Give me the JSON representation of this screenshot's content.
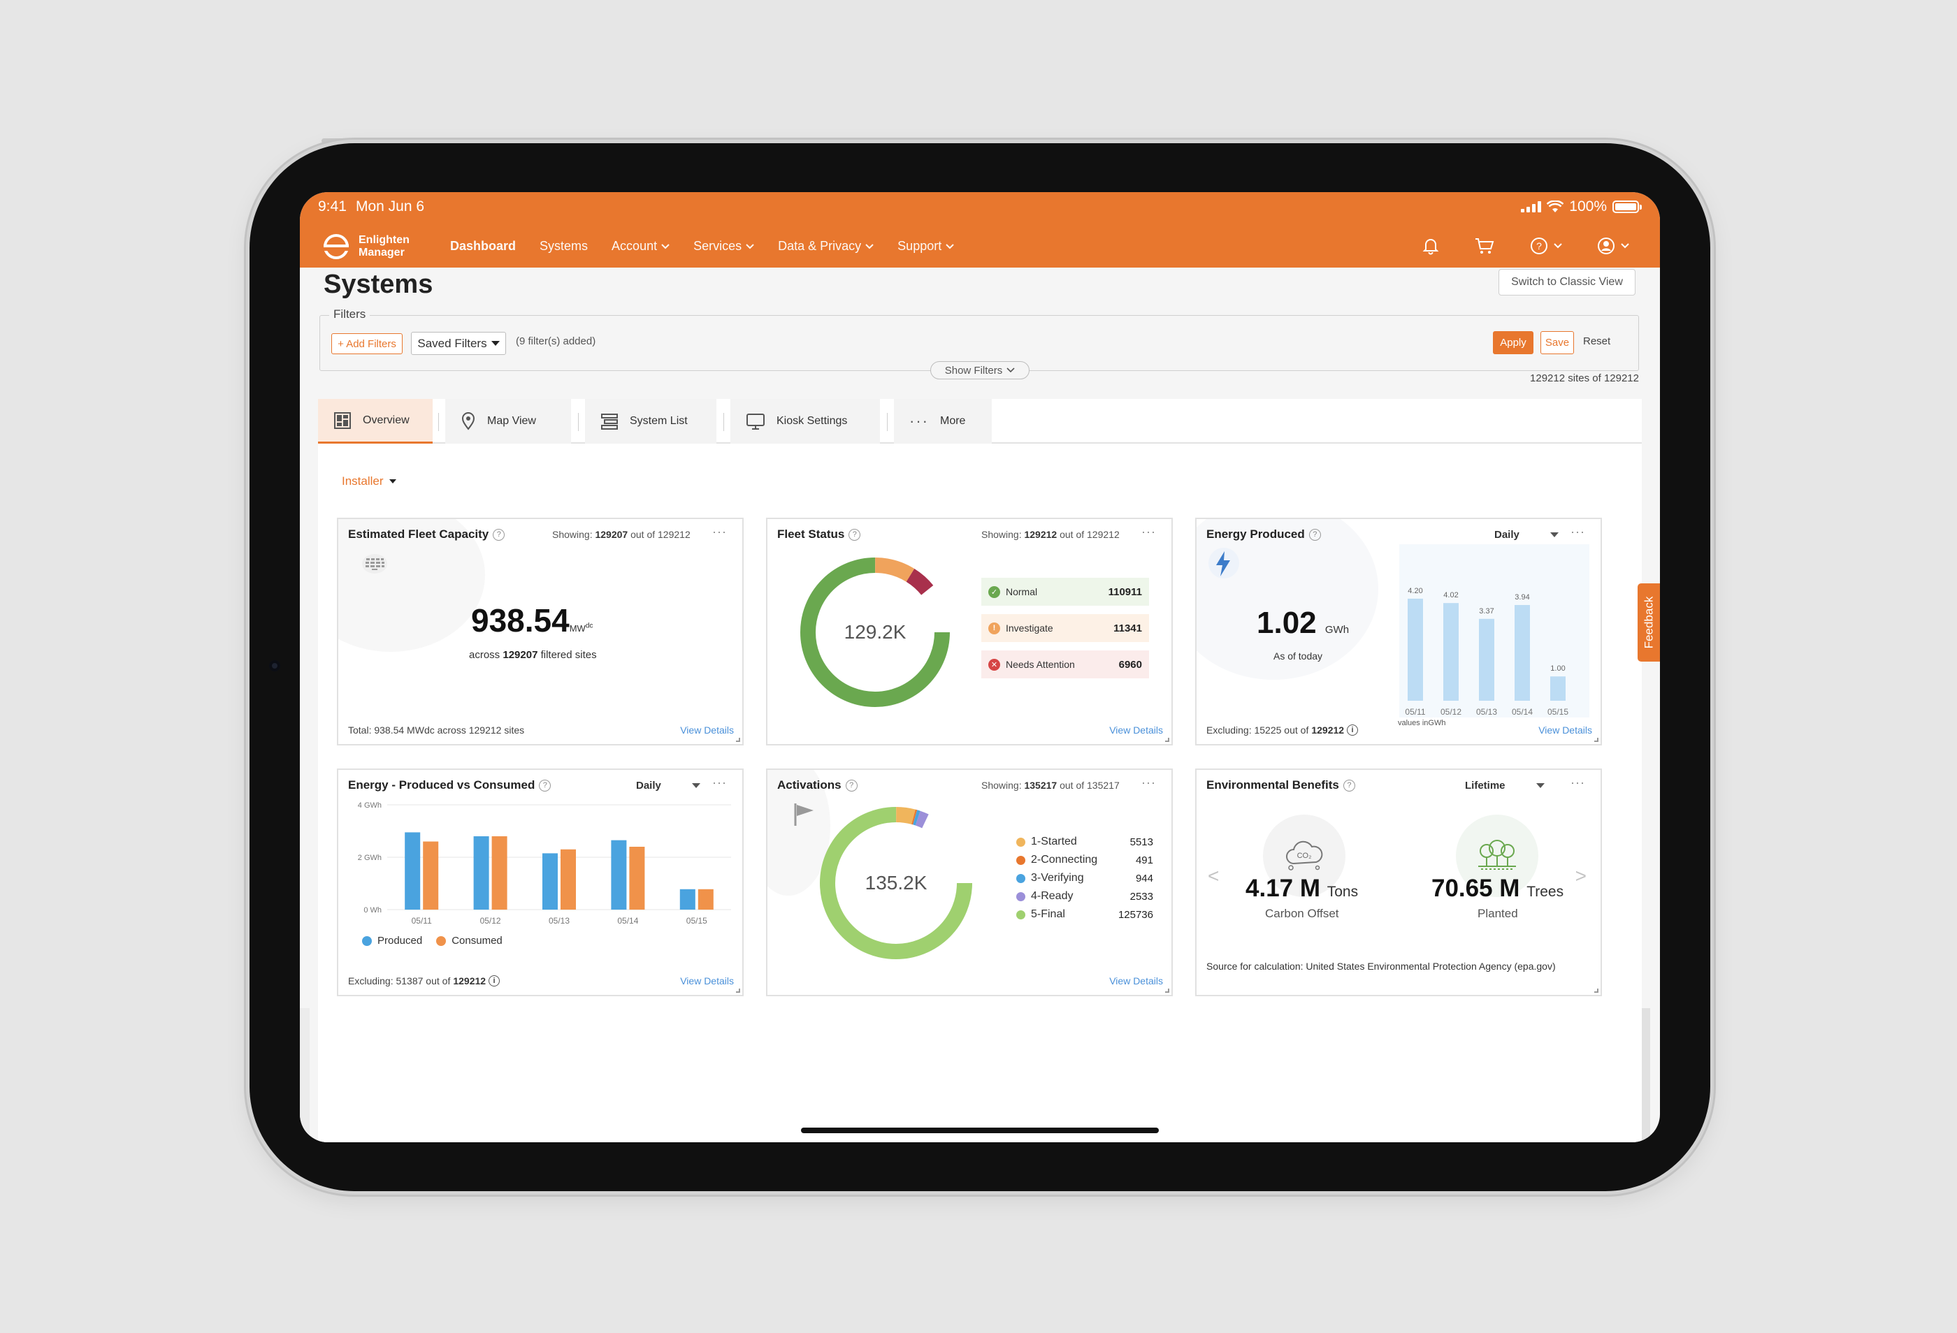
{
  "status_bar": {
    "time": "9:41",
    "date": "Mon Jun 6",
    "battery": "100%"
  },
  "nav": {
    "logo_line1": "Enlighten",
    "logo_line2": "Manager",
    "items": [
      {
        "label": "Dashboard",
        "active": true,
        "dropdown": false
      },
      {
        "label": "Systems",
        "active": false,
        "dropdown": false
      },
      {
        "label": "Account",
        "active": false,
        "dropdown": true
      },
      {
        "label": "Services",
        "active": false,
        "dropdown": true
      },
      {
        "label": "Data & Privacy",
        "active": false,
        "dropdown": true
      },
      {
        "label": "Support",
        "active": false,
        "dropdown": true
      }
    ],
    "icons": [
      "bell-icon",
      "cart-icon",
      "help-icon",
      "user-icon"
    ]
  },
  "page": {
    "title": "Systems",
    "classic_view_label": "Switch to Classic View",
    "sites_count": "129212 sites of 129212"
  },
  "filters": {
    "legend": "Filters",
    "add_label": "+ Add Filters",
    "saved_label": "Saved Filters",
    "count_text": "(9 filter(s) added)",
    "apply_label": "Apply",
    "save_label": "Save",
    "reset_label": "Reset",
    "show_label": "Show Filters"
  },
  "tabs": [
    {
      "label": "Overview",
      "icon": "grid-icon",
      "active": true
    },
    {
      "label": "Map View",
      "icon": "map-pin-icon",
      "active": false
    },
    {
      "label": "System List",
      "icon": "list-icon",
      "active": false
    },
    {
      "label": "Kiosk Settings",
      "icon": "monitor-icon",
      "active": false
    },
    {
      "label": "More",
      "icon": "ellipsis-icon",
      "active": false
    }
  ],
  "installer_label": "Installer",
  "cards": {
    "capacity": {
      "title": "Estimated Fleet Capacity",
      "showing_prefix": "Showing:",
      "showing_count": "129207",
      "showing_suffix": "out of 129212",
      "value": "938.54",
      "unit": "MWdc",
      "sub_prefix": "across",
      "sub_count": "129207",
      "sub_suffix": "filtered sites",
      "footer": "Total: 938.54 MWdc across 129212 sites",
      "view_details": "View Details"
    },
    "fleet": {
      "title": "Fleet Status",
      "showing_prefix": "Showing:",
      "showing_count": "129212",
      "showing_suffix": "out of 129212",
      "total_label": "129.2K",
      "rows": [
        {
          "label": "Normal",
          "value": "110911",
          "color": "#6aa84f",
          "bg": "#eef6ea",
          "symbol": "✓"
        },
        {
          "label": "Investigate",
          "value": "11341",
          "color": "#f0a35c",
          "bg": "#fdf1e6",
          "symbol": "!"
        },
        {
          "label": "Needs Attention",
          "value": "6960",
          "color": "#d64545",
          "bg": "#fbeceb",
          "symbol": "✕"
        }
      ],
      "segments": [
        {
          "value": 110911,
          "color": "#6aa84f"
        },
        {
          "value": 11341,
          "color": "#f0a35c"
        },
        {
          "value": 6960,
          "color": "#a8304c"
        }
      ],
      "view_details": "View Details"
    },
    "energy": {
      "title": "Energy Produced",
      "period": "Daily",
      "value": "1.02",
      "unit": "GWh",
      "sub": "As of today",
      "footer_prefix": "Excluding: 15225 out of",
      "footer_count": "129212",
      "values_in": "values inGWh",
      "view_details": "View Details"
    },
    "pvc": {
      "title": "Energy - Produced vs Consumed",
      "period": "Daily",
      "legend_produced": "Produced",
      "legend_consumed": "Consumed",
      "footer_prefix": "Excluding: 51387 out of",
      "footer_count": "129212",
      "view_details": "View Details"
    },
    "activations": {
      "title": "Activations",
      "showing_prefix": "Showing:",
      "showing_count": "135217",
      "showing_suffix": "out of 135217",
      "total_label": "135.2K",
      "rows": [
        {
          "label": "1-Started",
          "value": "5513",
          "color": "#f0b55c"
        },
        {
          "label": "2-Connecting",
          "value": "491",
          "color": "#e8772e"
        },
        {
          "label": "3-Verifying",
          "value": "944",
          "color": "#4aa3df"
        },
        {
          "label": "4-Ready",
          "value": "2533",
          "color": "#9b8fd9"
        },
        {
          "label": "5-Final",
          "value": "125736",
          "color": "#9fd06f"
        }
      ],
      "view_details": "View Details"
    },
    "env": {
      "title": "Environmental Benefits",
      "period": "Lifetime",
      "carbon_value": "4.17 M",
      "carbon_unit": "Tons",
      "carbon_label": "Carbon Offset",
      "trees_value": "70.65 M",
      "trees_unit": "Trees",
      "trees_label": "Planted",
      "source": "Source for calculation: United States Environmental Protection Agency (epa.gov)"
    }
  },
  "feedback_label": "Feedback",
  "chart_data": [
    {
      "type": "bar",
      "title": "Energy Produced",
      "categories": [
        "05/11",
        "05/12",
        "05/13",
        "05/14",
        "05/15"
      ],
      "values": [
        4.2,
        4.02,
        3.37,
        3.94,
        1.0
      ],
      "ylabel": "",
      "ylim": [
        0,
        4.6
      ],
      "grid": false
    },
    {
      "type": "bar",
      "title": "Energy - Produced vs Consumed",
      "categories": [
        "05/11",
        "05/12",
        "05/13",
        "05/14",
        "05/15"
      ],
      "y_ticks": [
        "4 GWh",
        "2 GWh",
        "0 Wh"
      ],
      "ylim": [
        0,
        4
      ],
      "grid": true,
      "legend": "bottom-left",
      "series": [
        {
          "name": "Produced",
          "color": "#4aa3df",
          "values": [
            2.95,
            2.8,
            2.15,
            2.65,
            0.78
          ]
        },
        {
          "name": "Consumed",
          "color": "#f0924a",
          "values": [
            2.6,
            2.8,
            2.3,
            2.4,
            0.78
          ]
        }
      ]
    },
    {
      "type": "pie",
      "title": "Fleet Status",
      "categories": [
        "Normal",
        "Investigate",
        "Needs Attention"
      ],
      "values": [
        110911,
        11341,
        6960
      ]
    },
    {
      "type": "pie",
      "title": "Activations",
      "categories": [
        "1-Started",
        "2-Connecting",
        "3-Verifying",
        "4-Ready",
        "5-Final"
      ],
      "values": [
        5513,
        491,
        944,
        2533,
        125736
      ]
    }
  ]
}
